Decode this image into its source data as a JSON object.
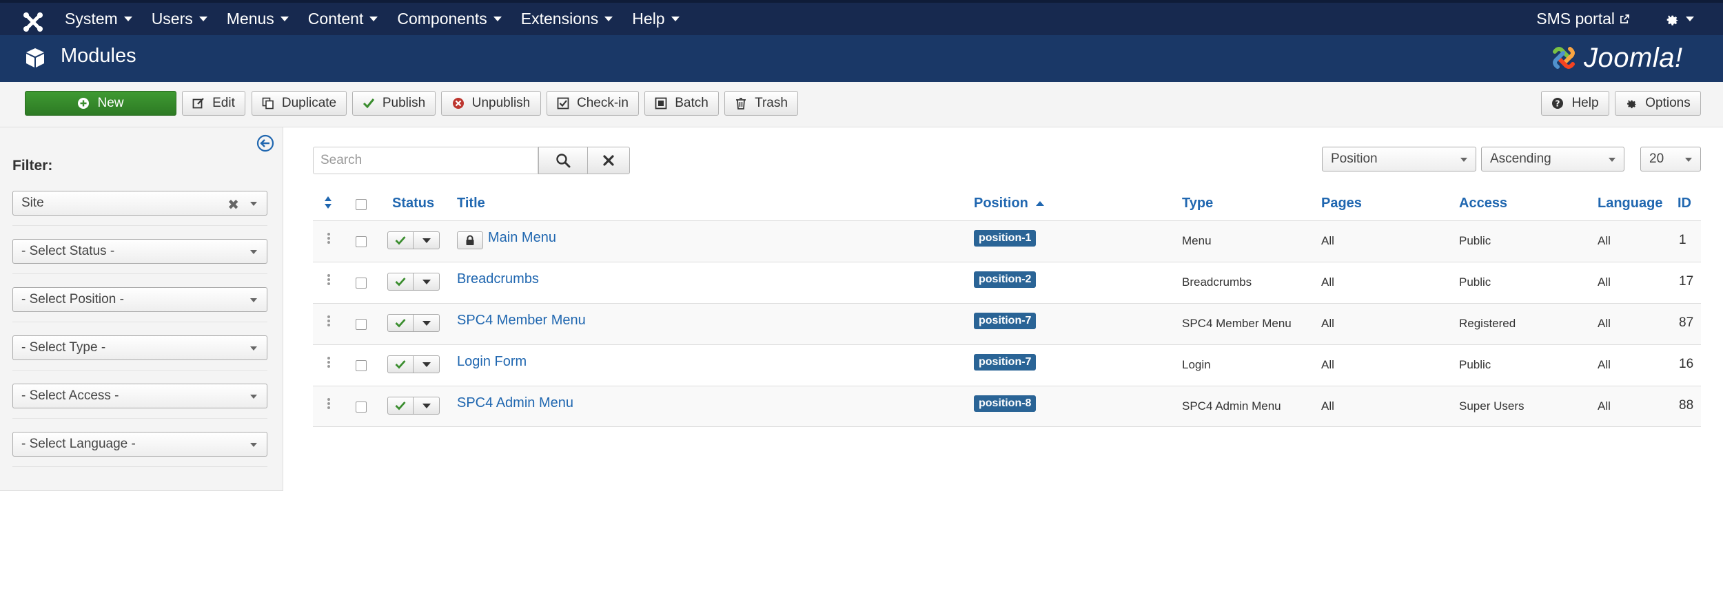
{
  "navbar": {
    "items": [
      "System",
      "Users",
      "Menus",
      "Content",
      "Components",
      "Extensions",
      "Help"
    ],
    "site_link": "SMS portal"
  },
  "header": {
    "title": "Modules",
    "brand": "Joomla!"
  },
  "toolbar": {
    "new": "New",
    "edit": "Edit",
    "duplicate": "Duplicate",
    "publish": "Publish",
    "unpublish": "Unpublish",
    "checkin": "Check-in",
    "batch": "Batch",
    "trash": "Trash",
    "help": "Help",
    "options": "Options"
  },
  "sidebar": {
    "filter_label": "Filter:",
    "client": "Site",
    "status": "- Select Status -",
    "position": "- Select Position -",
    "type": "- Select Type -",
    "access": "- Select Access -",
    "language": "- Select Language -"
  },
  "search": {
    "placeholder": "Search"
  },
  "list_controls": {
    "order_by": "Position",
    "direction": "Ascending",
    "limit": "20"
  },
  "table": {
    "headers": {
      "status": "Status",
      "title": "Title",
      "position": "Position",
      "type": "Type",
      "pages": "Pages",
      "access": "Access",
      "language": "Language",
      "id": "ID"
    },
    "rows": [
      {
        "title": "Main Menu",
        "position": "position-1",
        "type": "Menu",
        "pages": "All",
        "access": "Public",
        "language": "All",
        "id": "1"
      },
      {
        "title": "Breadcrumbs",
        "position": "position-2",
        "type": "Breadcrumbs",
        "pages": "All",
        "access": "Public",
        "language": "All",
        "id": "17"
      },
      {
        "title": "SPC4 Member Menu",
        "position": "position-7",
        "type": "SPC4 Member Menu",
        "pages": "All",
        "access": "Registered",
        "language": "All",
        "id": "87"
      },
      {
        "title": "Login Form",
        "position": "position-7",
        "type": "Login",
        "pages": "All",
        "access": "Public",
        "language": "All",
        "id": "16"
      },
      {
        "title": "SPC4 Admin Menu",
        "position": "position-8",
        "type": "SPC4 Admin Menu",
        "pages": "All",
        "access": "Super Users",
        "language": "All",
        "id": "88"
      }
    ]
  },
  "colors": {
    "navbar": "#17294f",
    "header": "#1a3867",
    "link": "#2067b0",
    "badge": "#2a6496",
    "success": "#3f9a32"
  }
}
